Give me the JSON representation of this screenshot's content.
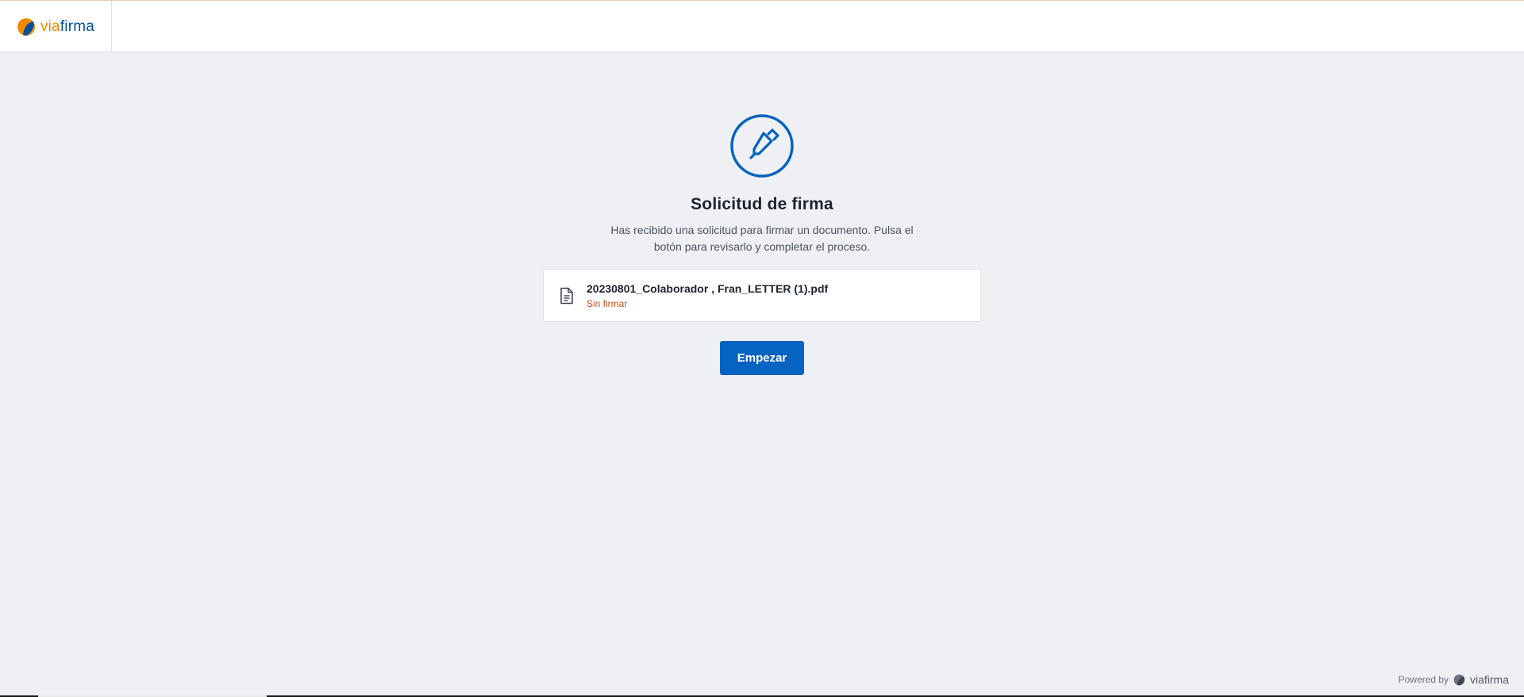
{
  "header": {
    "logo": {
      "part1": "via",
      "part2": "firma"
    }
  },
  "main": {
    "icon": "signature-pen-icon",
    "title": "Solicitud de firma",
    "description": "Has recibido una solicitud para firmar un documento. Pulsa el botón para revisarlo y completar el proceso.",
    "document": {
      "icon": "document-icon",
      "name": "20230801_Colaborador , Fran_LETTER (1).pdf",
      "status": "Sin firmar"
    },
    "start_button": "Empezar"
  },
  "footer": {
    "powered_by": "Powered by",
    "brand": "viafirma"
  },
  "colors": {
    "primary": "#0563c1",
    "brand_orange": "#f18a00",
    "brand_blue": "#004f9f",
    "status_unsigned": "#c0521b",
    "background": "#eff0f4"
  }
}
